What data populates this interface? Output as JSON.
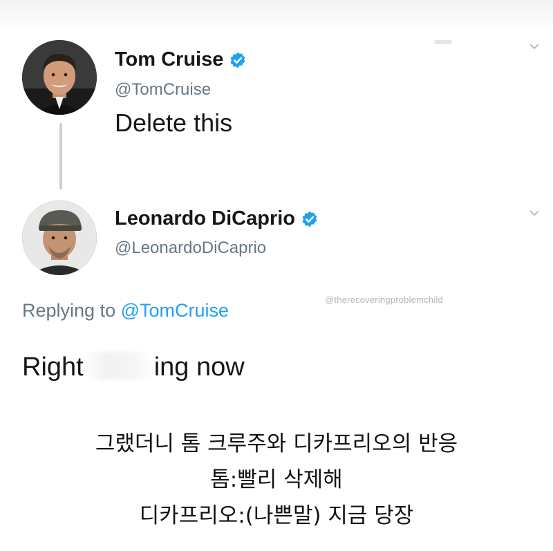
{
  "tweet1": {
    "name": "Tom Cruise",
    "handle": "@TomCruise",
    "text": "Delete this"
  },
  "tweet2": {
    "name": "Leonardo DiCaprio",
    "handle": "@LeonardoDiCaprio",
    "replying_prefix": "Replying to ",
    "replying_mention": "@TomCruise",
    "text_before": "Right",
    "text_after": "ing now"
  },
  "watermark": "@therecoveringproblemchild",
  "caption": {
    "line1": "그랬더니 톰 크루주와 디카프리오의 반응",
    "line2": "톰:빨리 삭제해",
    "line3": "디카프리오:(나쁜말) 지금 당장"
  },
  "colors": {
    "verified": "#1da1f2",
    "handle": "#657786",
    "mention": "#1da1f2",
    "text": "#14171a"
  },
  "icons": {
    "verified": "verified-badge-icon",
    "menu": "chevron-down-icon"
  }
}
